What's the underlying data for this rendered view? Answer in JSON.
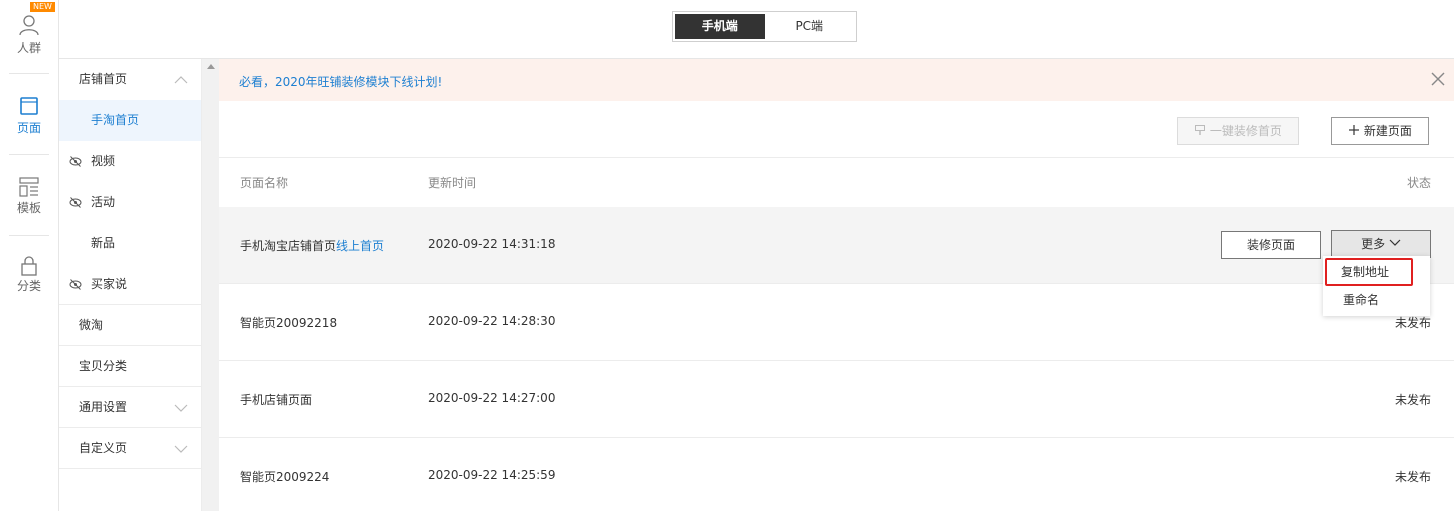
{
  "rail": {
    "badge": "NEW",
    "items": [
      {
        "label": "人群",
        "icon": "person-icon"
      },
      {
        "label": "页面",
        "icon": "page-icon"
      },
      {
        "label": "模板",
        "icon": "template-icon"
      },
      {
        "label": "分类",
        "icon": "bag-icon"
      }
    ]
  },
  "topbar": {
    "tabs": [
      "手机端",
      "PC端"
    ],
    "active_tab": "手机端"
  },
  "subnav": {
    "group_title": "店铺首页",
    "children": [
      {
        "label": "手淘首页",
        "active": true,
        "hidden_icon": false
      },
      {
        "label": "视频",
        "active": false,
        "hidden_icon": true
      },
      {
        "label": "活动",
        "active": false,
        "hidden_icon": true
      },
      {
        "label": "新品",
        "active": false,
        "hidden_icon": false
      },
      {
        "label": "买家说",
        "active": false,
        "hidden_icon": true
      }
    ],
    "sections": [
      "微淘",
      "宝贝分类",
      "通用设置",
      "自定义页"
    ]
  },
  "notice": {
    "text": "必看，2020年旺铺装修模块下线计划!"
  },
  "toolbar": {
    "one_click_label": "一键装修首页",
    "new_page_label": "新建页面"
  },
  "table": {
    "headers": {
      "name": "页面名称",
      "time": "更新时间",
      "status": "状态"
    },
    "rows": [
      {
        "name": "手机淘宝店铺首页",
        "tag": "线上首页",
        "time": "2020-09-22 14:31:18",
        "status": ""
      },
      {
        "name": "智能页20092218",
        "tag": "",
        "time": "2020-09-22 14:28:30",
        "status": "未发布"
      },
      {
        "name": "手机店铺页面",
        "tag": "",
        "time": "2020-09-22 14:27:00",
        "status": "未发布"
      },
      {
        "name": "智能页2009224",
        "tag": "",
        "time": "2020-09-22 14:25:59",
        "status": "未发布"
      }
    ],
    "decorate_label": "装修页面",
    "more_label": "更多"
  },
  "dropdown": {
    "items": [
      "复制地址",
      "重命名"
    ]
  },
  "colors": {
    "accent": "#1d7fd1",
    "notice_bg": "#fdf1ec",
    "highlight_border": "#e02020"
  }
}
